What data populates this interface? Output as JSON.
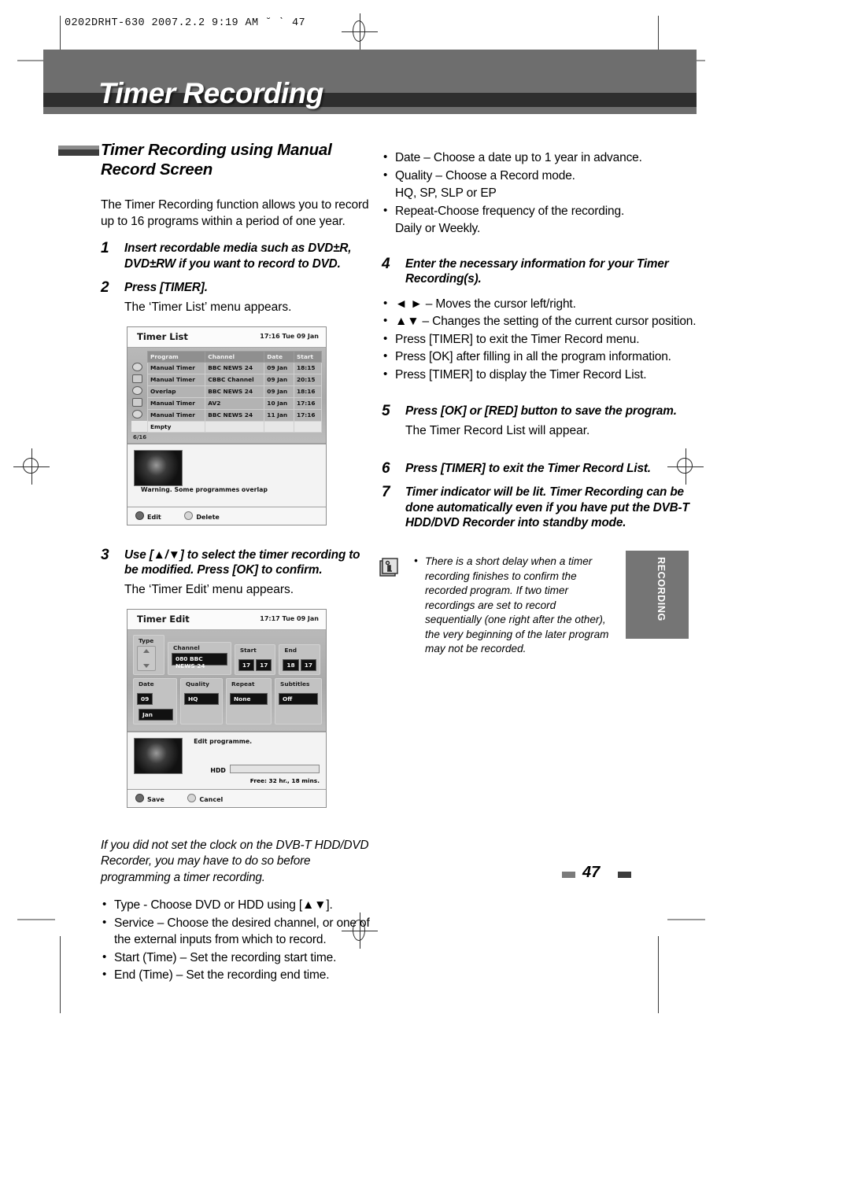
{
  "print_slug": "0202DRHT-630 2007.2.2 9:19 AM  ˘      ˋ    47",
  "chapter_title": "Timer Recording",
  "section": {
    "heading": "Timer Recording using Manual Record Screen",
    "intro": "The Timer Recording function allows you to record up to 16 programs within a period of one year."
  },
  "steps": {
    "s1": {
      "num": "1",
      "text": "Insert recordable media such as DVD±R, DVD±RW if you want to record to DVD."
    },
    "s2": {
      "num": "2",
      "text": "Press [TIMER].",
      "sub": "The ‘Timer List’ menu appears."
    },
    "s3": {
      "num": "3",
      "text": "Use [▲/▼] to select the timer recording to be modified. Press [OK] to confirm.",
      "sub": "The ‘Timer Edit’ menu appears."
    },
    "s4": {
      "num": "4",
      "text": "Enter the necessary information for your Timer Recording(s)."
    },
    "s5": {
      "num": "5",
      "text": "Press [OK] or [RED] button to save the program.",
      "sub": "The Timer Record List will appear."
    },
    "s6": {
      "num": "6",
      "text": "Press [TIMER] to exit the Timer Record List."
    },
    "s7": {
      "num": "7",
      "text": "Timer indicator will be lit. Timer Recording can be done automatically even if you have put the DVB-T HDD/DVD Recorder into standby mode."
    }
  },
  "clock_note": "If you did not set the clock on the DVB-T HDD/DVD Recorder, you may have to do so before programming a timer recording.",
  "left_bullets": [
    "Type - Choose DVD or HDD using [▲▼].",
    "Service – Choose the desired channel, or one of the external inputs from which to record.",
    "Start (Time) – Set the recording start time.",
    "End (Time) – Set the recording end time."
  ],
  "right_bullets_top": [
    "Date – Choose a date up to 1 year in advance.",
    "Quality – Choose a Record mode.",
    "HQ, SP, SLP or EP",
    "Repeat-Choose frequency of the recording.",
    "Daily or Weekly."
  ],
  "step4_bullets": [
    "◄ ►  – Moves the cursor left/right.",
    "▲▼  – Changes the setting of the current cursor position.",
    "Press [TIMER] to exit the Timer Record menu.",
    "Press [OK] after filling in all the program information.",
    "Press [TIMER] to display the Timer Record List."
  ],
  "note": {
    "icon": "info-icon",
    "text": "There is a short delay when a timer recording finishes to confirm the recorded program. If two timer recordings are set to record sequentially (one right after the other), the very beginning of the later program may not be recorded."
  },
  "side_tab": "RECORDING",
  "page_number": "47",
  "timer_list": {
    "title": "Timer List",
    "clock": "17:16 Tue 09 Jan",
    "columns": [
      "Program",
      "Channel",
      "Date",
      "Start"
    ],
    "rows": [
      {
        "icon": "disc-icon",
        "program": "Manual Timer",
        "channel": "BBC NEWS 24",
        "date": "09 Jan",
        "start": "18:15"
      },
      {
        "icon": "disc-icon",
        "program": "Manual Timer",
        "channel": "CBBC Channel",
        "date": "09 Jan",
        "start": "20:15"
      },
      {
        "icon": "disc-icon",
        "program": "Overlap",
        "channel": "BBC NEWS 24",
        "date": "09 Jan",
        "start": "18:16"
      },
      {
        "icon": "disc-icon",
        "program": "Manual Timer",
        "channel": "AV2",
        "date": "10 Jan",
        "start": "17:16"
      },
      {
        "icon": "disc-icon",
        "program": "Manual Timer",
        "channel": "BBC NEWS 24",
        "date": "11 Jan",
        "start": "17:16"
      },
      {
        "icon": "",
        "program": "Empty",
        "channel": "",
        "date": "",
        "start": ""
      }
    ],
    "counter": "6/16",
    "warning": "Warning. Some programmes overlap",
    "buttons": [
      {
        "key": "red",
        "label": "Edit"
      },
      {
        "key": "grey",
        "label": "Delete"
      }
    ]
  },
  "timer_edit": {
    "title": "Timer Edit",
    "clock": "17:17 Tue 09 Jan",
    "labels": {
      "type": "Type",
      "channel": "Channel",
      "start": "Start",
      "end": "End",
      "date": "Date",
      "quality": "Quality",
      "repeat": "Repeat",
      "subtitles": "Subtitles"
    },
    "values": {
      "channel": "080 BBC NEWS 24",
      "start_h": "17",
      "start_m": "17",
      "end_h": "18",
      "end_m": "17",
      "date_day": "09",
      "date_month": "Jan",
      "quality": "HQ",
      "repeat": "None",
      "subtitles": "Off"
    },
    "status": "Edit programme.",
    "hdd_label": "HDD",
    "hdd_free": "Free: 32 hr., 18 mins.",
    "buttons": [
      {
        "key": "red",
        "label": "Save"
      },
      {
        "key": "grey",
        "label": "Cancel"
      }
    ]
  }
}
